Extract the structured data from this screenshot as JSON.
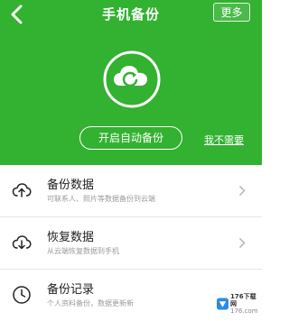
{
  "header": {
    "title": "手机备份",
    "more_label": "更多"
  },
  "hero": {
    "auto_backup_label": "开启自动备份",
    "no_need_label": "我不需要"
  },
  "list": {
    "items": [
      {
        "label": "备份数据",
        "desc": "可联系人、照片等数据备份到云端",
        "icon": "cloud-upload-icon"
      },
      {
        "label": "恢复数据",
        "desc": "从云端恢复数据到手机",
        "icon": "cloud-download-icon"
      },
      {
        "label": "备份记录",
        "desc": "个人资料备份，数据更新新",
        "icon": "clock-icon"
      }
    ]
  },
  "watermark": {
    "brand": "176下载网",
    "site": "176.com"
  },
  "colors": {
    "brand_green": "#33b131",
    "text_dark": "#222222",
    "text_gray": "#9a9a9a"
  }
}
